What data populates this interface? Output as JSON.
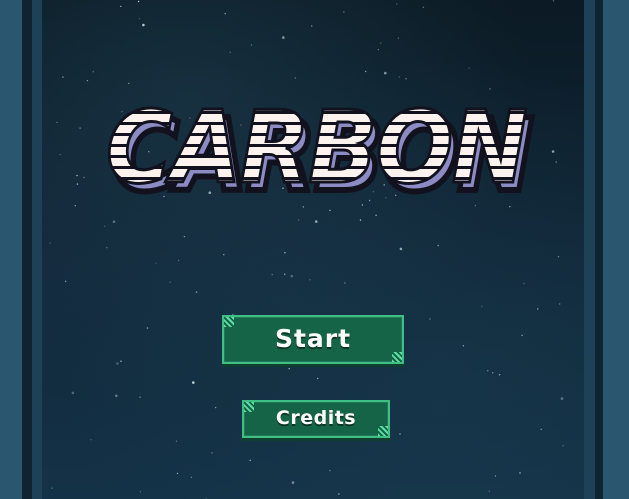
{
  "game": {
    "title": "CARBON"
  },
  "menu": {
    "start_label": "Start",
    "credits_label": "Credits"
  },
  "colors": {
    "background_dark": "#0b1a24",
    "frame": "#2a5670",
    "title_fill": "#fdf3ee",
    "title_shadow": "#8c8bc4",
    "title_outline": "#12121e",
    "button_fill": "#166447",
    "button_border": "#3fbf86"
  }
}
